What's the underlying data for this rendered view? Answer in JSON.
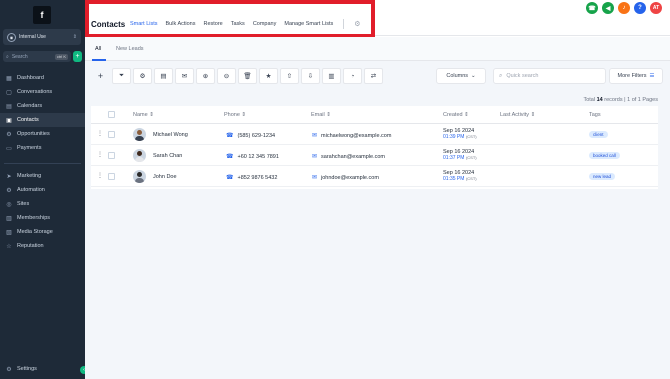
{
  "sidebar": {
    "logo": "f",
    "account": "Internal Use",
    "search_placeholder": "Search",
    "search_kbd": "ctrl K",
    "items": [
      {
        "label": "Dashboard",
        "icon": "grid-icon"
      },
      {
        "label": "Conversations",
        "icon": "chat-icon"
      },
      {
        "label": "Calendars",
        "icon": "calendar-icon"
      },
      {
        "label": "Contacts",
        "icon": "contacts-icon",
        "active": true
      },
      {
        "label": "Opportunities",
        "icon": "funnel-icon"
      },
      {
        "label": "Payments",
        "icon": "card-icon"
      }
    ],
    "items2": [
      {
        "label": "Marketing",
        "icon": "send-icon"
      },
      {
        "label": "Automation",
        "icon": "automation-icon"
      },
      {
        "label": "Sites",
        "icon": "globe-icon"
      },
      {
        "label": "Memberships",
        "icon": "members-icon"
      },
      {
        "label": "Media Storage",
        "icon": "media-icon"
      },
      {
        "label": "Reputation",
        "icon": "star-icon"
      }
    ],
    "settings": "Settings"
  },
  "header": {
    "title": "Contacts",
    "tabs": [
      "Smart Lists",
      "Bulk Actions",
      "Restore",
      "Tasks",
      "Company",
      "Manage Smart Lists"
    ],
    "active_tab": "Smart Lists",
    "icons": [
      {
        "name": "phone-icon",
        "color": "#16a34a",
        "glyph": "☎"
      },
      {
        "name": "megaphone-icon",
        "color": "#16a34a",
        "glyph": "▶"
      },
      {
        "name": "bell-icon",
        "color": "#f97316",
        "glyph": "♪"
      },
      {
        "name": "help-icon",
        "color": "#2563eb",
        "glyph": "?"
      },
      {
        "name": "avatar-icon",
        "color": "#ef4444",
        "glyph": "AT"
      }
    ]
  },
  "subtabs": [
    "All",
    "New Leads"
  ],
  "toolbar": {
    "columns_label": "Columns",
    "search_placeholder": "Quick search",
    "more_filters": "More Filters"
  },
  "records": {
    "prefix": "Total ",
    "count": "14",
    "suffix": " records | 1 of 1 Pages"
  },
  "table": {
    "headers": [
      "Name",
      "Phone",
      "Email",
      "Created",
      "Last Activity",
      "Tags"
    ],
    "rows": [
      {
        "name": "Michael Wong",
        "phone": "(585) 629-1234",
        "email": "michaelwong@example.com",
        "date": "Sep 16 2024",
        "time": "01:39 PM",
        "tz": "(CST)",
        "tag": "client"
      },
      {
        "name": "Sarah Chan",
        "phone": "+60 12 345 7891",
        "email": "sarahchan@example.com",
        "date": "Sep 16 2024",
        "time": "01:37 PM",
        "tz": "(CST)",
        "tag": "booked call"
      },
      {
        "name": "John Doe",
        "phone": "+852 9876 5432",
        "email": "johndoe@example.com",
        "date": "Sep 16 2024",
        "time": "01:35 PM",
        "tz": "(CST)",
        "tag": "new lead"
      }
    ]
  },
  "colors": {
    "sidebar_bg": "#1e2a38",
    "accent": "#2563eb",
    "highlight": "#e11d2a",
    "green": "#10b981"
  }
}
